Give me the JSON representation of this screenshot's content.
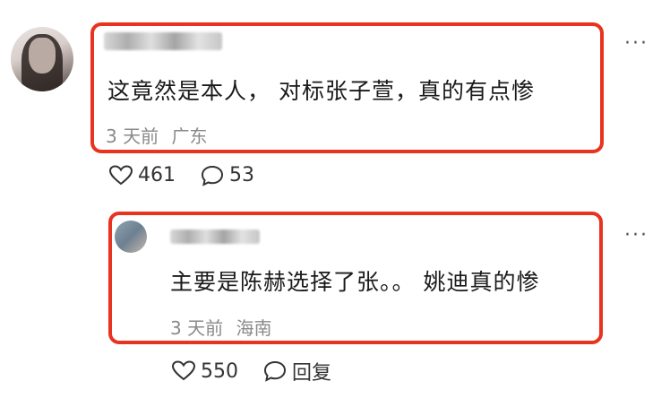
{
  "main_comment": {
    "text": "这竟然是本人， 对标张子萱，真的有点惨",
    "time": "3 天前",
    "location": "广东",
    "likes": "461",
    "replies": "53"
  },
  "reply_comment": {
    "text": "主要是陈赫选择了张。。 姚迪真的惨",
    "time": "3 天前",
    "location": "海南",
    "likes": "550",
    "reply_label": "回复"
  },
  "more_label": "···",
  "colors": {
    "highlight": "#e8331f",
    "meta": "#8a8a8a"
  },
  "icons": [
    "heart-icon",
    "comment-icon",
    "more-icon"
  ]
}
